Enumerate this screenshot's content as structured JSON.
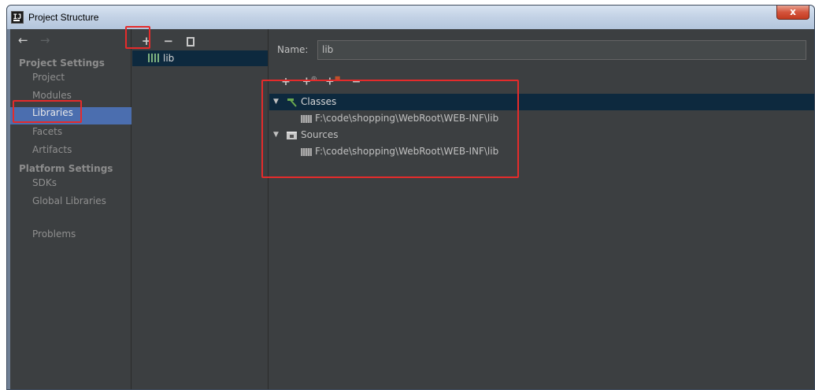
{
  "window": {
    "title": "Project Structure",
    "app_icon_text": "IJ",
    "close_label": "x"
  },
  "nav": {
    "back_arrow": "←",
    "forward_arrow": "→",
    "sections": [
      {
        "heading": "Project Settings",
        "items": [
          "Project",
          "Modules",
          "Libraries",
          "Facets",
          "Artifacts"
        ]
      },
      {
        "heading": "Platform Settings",
        "items": [
          "SDKs",
          "Global Libraries"
        ]
      }
    ],
    "problems": "Problems",
    "selected": "Libraries"
  },
  "libraries": {
    "toolbar": {
      "add": "+",
      "remove": "−"
    },
    "items": [
      {
        "label": "lib"
      }
    ]
  },
  "detail": {
    "name_label": "Name:",
    "name_value": "lib",
    "roots_toolbar": {
      "add": "+",
      "add_spec": "+",
      "add_remote": "+",
      "remove": "−"
    },
    "tree": [
      {
        "label": "Classes",
        "path": "F:\\code\\shopping\\WebRoot\\WEB-INF\\lib"
      },
      {
        "label": "Sources",
        "path": "F:\\code\\shopping\\WebRoot\\WEB-INF\\lib"
      }
    ]
  },
  "colors": {
    "background": "#3c3f41",
    "selection": "#4b6eaf",
    "tree_selection": "#0d293e",
    "annotation": "#e52b2b"
  }
}
